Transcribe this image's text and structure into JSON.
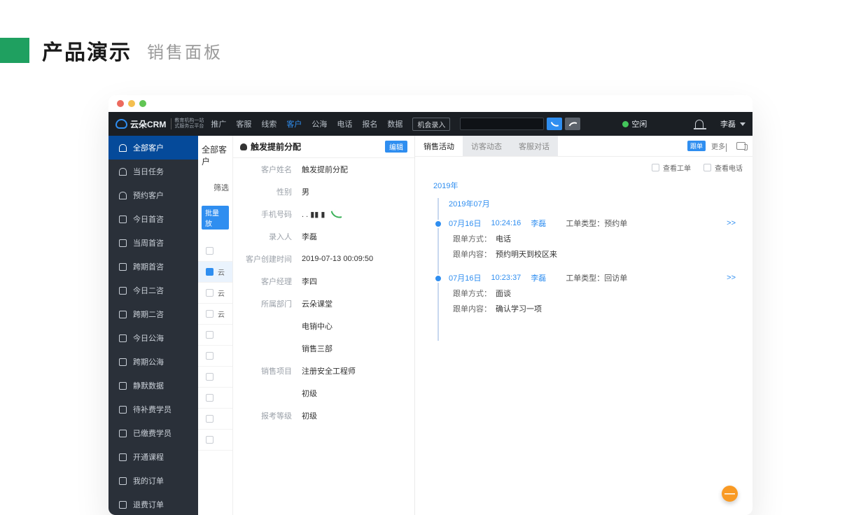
{
  "slide": {
    "title": "产品演示",
    "subtitle": "销售面板"
  },
  "topnav": {
    "brand": "云朵CRM",
    "brand_tag1": "教育机构一站",
    "brand_tag2": "式服务云平台",
    "items": [
      "推广",
      "客服",
      "线索",
      "客户",
      "公海",
      "电话",
      "报名",
      "数据"
    ],
    "active_index": 3,
    "opportunity": "机会录入",
    "status": "空闲",
    "user": "李磊"
  },
  "sidebar": {
    "items": [
      "全部客户",
      "当日任务",
      "预约客户",
      "今日首咨",
      "当周首咨",
      "跨期首咨",
      "今日二咨",
      "跨期二咨",
      "今日公海",
      "跨期公海",
      "静默数据",
      "待补费学员",
      "已缴费学员",
      "开通课程",
      "我的订单",
      "退费订单"
    ],
    "active_index": 0
  },
  "mid": {
    "header": "全部客户",
    "filter": "筛选",
    "batch": "批量放",
    "rows": [
      "",
      "云",
      "云",
      "云",
      "",
      "",
      "",
      "",
      "",
      ""
    ],
    "selected_index": 1
  },
  "detail": {
    "title": "触发提前分配",
    "edit": "编辑",
    "fields": {
      "name_k": "客户姓名",
      "name_v": "触发提前分配",
      "gender_k": "性别",
      "gender_v": "男",
      "phone_k": "手机号码",
      "phone_v": ". . ▮▮ ▮",
      "entry_k": "录入人",
      "entry_v": "李磊",
      "create_k": "客户创建时间",
      "create_v": "2019-07-13 00:09:50",
      "mgr_k": "客户经理",
      "mgr_v": "李四",
      "dept_k": "所属部门",
      "dept_v": "云朵课堂",
      "dept2": "电销中心",
      "dept3": "销售三部",
      "proj_k": "销售项目",
      "proj_v": "注册安全工程师",
      "proj2": "初级",
      "level_k": "报考等级",
      "level_v": "初级"
    }
  },
  "activity": {
    "tabs": [
      "销售活动",
      "访客动态",
      "客服对话"
    ],
    "badge": "跟单",
    "more": "更多",
    "opt1": "查看工单",
    "opt2": "查看电话",
    "year": "2019年",
    "month": "2019年07月",
    "items": [
      {
        "date": "07月16日",
        "time": "10:24:16",
        "who": "李磊",
        "type_k": "工单类型：",
        "type_v": "预约单",
        "m1k": "跟单方式：",
        "m1v": "电话",
        "m2k": "跟单内容：",
        "m2v": "预约明天到校区来",
        "expand": ">>"
      },
      {
        "date": "07月16日",
        "time": "10:23:37",
        "who": "李磊",
        "type_k": "工单类型：",
        "type_v": "回访单",
        "m1k": "跟单方式：",
        "m1v": "面谈",
        "m2k": "跟单内容：",
        "m2v": "确认学习一项",
        "expand": ">>"
      }
    ]
  },
  "fab": "—"
}
